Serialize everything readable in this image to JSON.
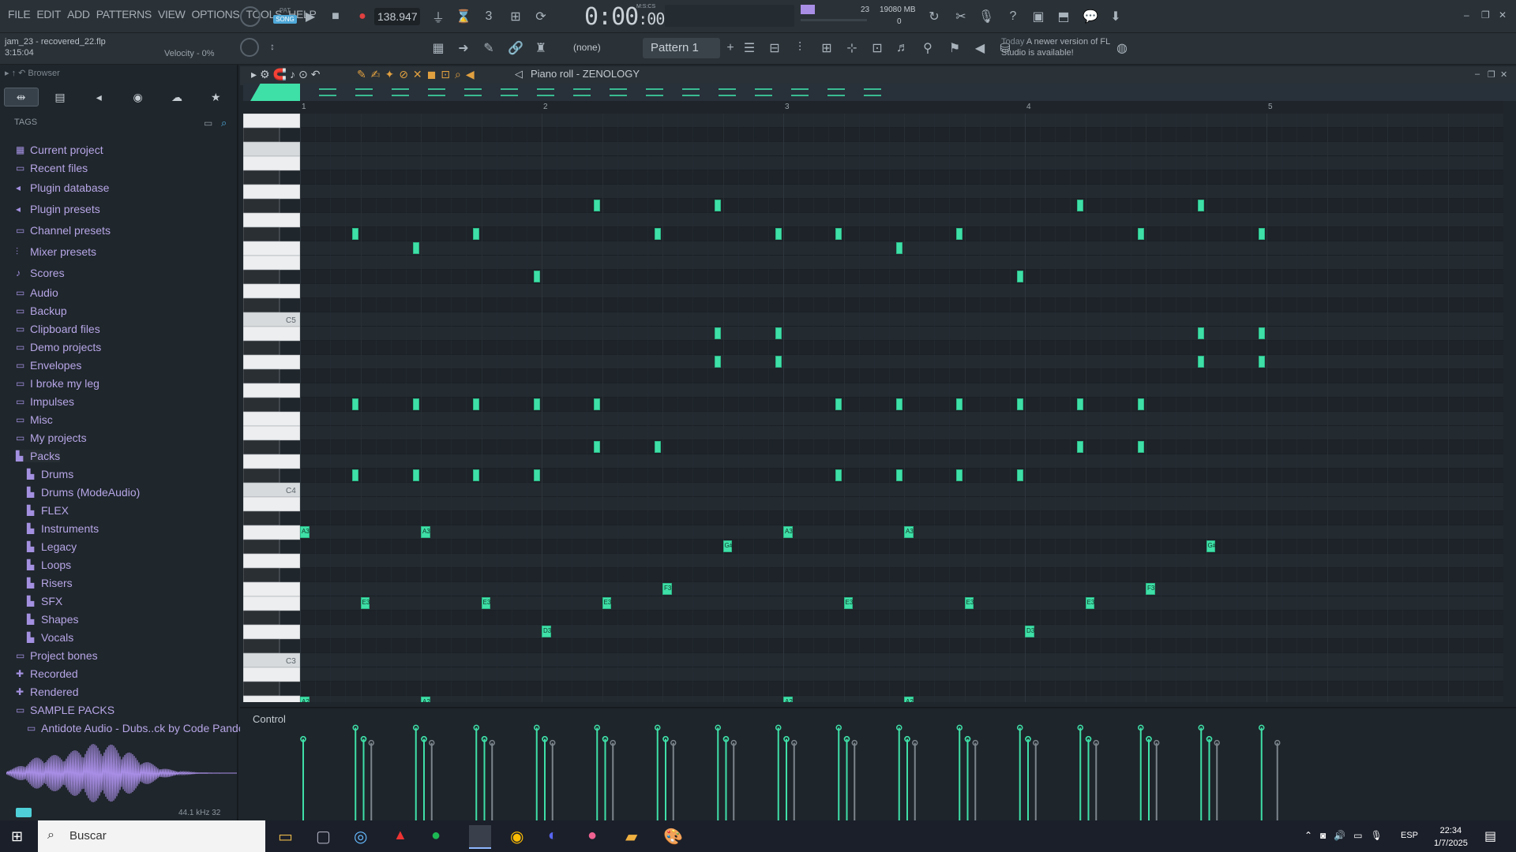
{
  "menu": [
    "FILE",
    "EDIT",
    "ADD",
    "PATTERNS",
    "VIEW",
    "OPTIONS",
    "TOOLS",
    "HELP"
  ],
  "transport": {
    "pat_label": "PAT",
    "song_label": "SONG",
    "bpm": "138.947",
    "time": "0:00",
    "time_sub": ":00",
    "time_unit": "M:S:CS"
  },
  "memory": {
    "cpu": "23",
    "mem": "19080 MB",
    "voices": "0"
  },
  "project": {
    "name": "jam_23 - recovered_22.flp",
    "time": "3:15:04",
    "velocity": "Velocity - 0%"
  },
  "pattern": {
    "name": "Pattern 1",
    "none": "(none)"
  },
  "news": {
    "today": "Today",
    "text": "A newer version of FL Studio is available!"
  },
  "browser": {
    "title": "Browser",
    "tags": "TAGS",
    "items": [
      {
        "label": "Current project",
        "icon": "project-icon"
      },
      {
        "label": "Recent files",
        "icon": "folder-icon"
      },
      {
        "label": "Plugin database",
        "icon": "plugin-icon"
      },
      {
        "label": "Plugin presets",
        "icon": "plugin-icon"
      },
      {
        "label": "Channel presets",
        "icon": "channel-icon"
      },
      {
        "label": "Mixer presets",
        "icon": "mixer-icon"
      },
      {
        "label": "Scores",
        "icon": "note-icon"
      },
      {
        "label": "Audio",
        "icon": "folder-icon"
      },
      {
        "label": "Backup",
        "icon": "folder-icon"
      },
      {
        "label": "Clipboard files",
        "icon": "folder-icon"
      },
      {
        "label": "Demo projects",
        "icon": "folder-icon"
      },
      {
        "label": "Envelopes",
        "icon": "folder-icon"
      },
      {
        "label": "I broke my leg",
        "icon": "folder-icon"
      },
      {
        "label": "Impulses",
        "icon": "folder-icon"
      },
      {
        "label": "Misc",
        "icon": "folder-icon"
      },
      {
        "label": "My projects",
        "icon": "folder-icon"
      },
      {
        "label": "Packs",
        "icon": "pack-icon"
      },
      {
        "label": "Drums",
        "icon": "pack-icon",
        "sub": true
      },
      {
        "label": "Drums (ModeAudio)",
        "icon": "pack-icon",
        "sub": true
      },
      {
        "label": "FLEX",
        "icon": "pack-icon",
        "sub": true
      },
      {
        "label": "Instruments",
        "icon": "pack-icon",
        "sub": true
      },
      {
        "label": "Legacy",
        "icon": "pack-icon",
        "sub": true
      },
      {
        "label": "Loops",
        "icon": "pack-icon",
        "sub": true
      },
      {
        "label": "Risers",
        "icon": "pack-icon",
        "sub": true
      },
      {
        "label": "SFX",
        "icon": "pack-icon",
        "sub": true
      },
      {
        "label": "Shapes",
        "icon": "pack-icon",
        "sub": true
      },
      {
        "label": "Vocals",
        "icon": "pack-icon",
        "sub": true
      },
      {
        "label": "Project bones",
        "icon": "folder-icon"
      },
      {
        "label": "Recorded",
        "icon": "plus-icon"
      },
      {
        "label": "Rendered",
        "icon": "plus-icon"
      },
      {
        "label": "SAMPLE PACKS",
        "icon": "folder-icon"
      },
      {
        "label": "Antidote Audio - Dubs..ck by Code Pandorum",
        "icon": "folder-icon",
        "sub": true
      }
    ],
    "samplerate": "44.1 kHz 32"
  },
  "pianoroll": {
    "title": "Piano roll - ZENOLOGY",
    "bars": [
      "1",
      "2",
      "3",
      "4",
      "5"
    ],
    "key_labels": [
      "C5",
      "C4",
      "C3"
    ],
    "control": "Control",
    "notes": [
      {
        "label": "A3",
        "bar": 0.0,
        "len": 0.13,
        "pitch": "A3"
      },
      {
        "label": "A3",
        "bar": 0.5,
        "len": 0.13,
        "pitch": "A3"
      },
      {
        "label": "A3",
        "bar": 2.0,
        "len": 0.13,
        "pitch": "A3"
      },
      {
        "label": "A3",
        "bar": 2.5,
        "len": 0.13,
        "pitch": "A3"
      },
      {
        "label": "G#3",
        "bar": 1.75,
        "len": 0.13,
        "pitch": "G#3"
      },
      {
        "label": "G#3",
        "bar": 3.75,
        "len": 0.13,
        "pitch": "G#3"
      },
      {
        "label": "F3",
        "bar": 1.5,
        "len": 0.13,
        "pitch": "F3"
      },
      {
        "label": "F3",
        "bar": 3.5,
        "len": 0.13,
        "pitch": "F3"
      },
      {
        "label": "E3",
        "bar": 0.25,
        "len": 0.13,
        "pitch": "E3"
      },
      {
        "label": "E3",
        "bar": 0.75,
        "len": 0.13,
        "pitch": "E3"
      },
      {
        "label": "E3",
        "bar": 1.25,
        "len": 0.13,
        "pitch": "E3"
      },
      {
        "label": "E3",
        "bar": 2.25,
        "len": 0.13,
        "pitch": "E3"
      },
      {
        "label": "E3",
        "bar": 2.75,
        "len": 0.13,
        "pitch": "E3"
      },
      {
        "label": "E3",
        "bar": 3.25,
        "len": 0.13,
        "pitch": "E3"
      },
      {
        "label": "D3",
        "bar": 1.0,
        "len": 0.13,
        "pitch": "D3"
      },
      {
        "label": "D3",
        "bar": 3.0,
        "len": 0.13,
        "pitch": "D3"
      },
      {
        "label": "A2",
        "bar": 0.0,
        "len": 0.13,
        "pitch": "A2"
      },
      {
        "label": "A2",
        "bar": 0.5,
        "len": 0.13,
        "pitch": "A2"
      },
      {
        "label": "A2",
        "bar": 2.0,
        "len": 0.13,
        "pitch": "A2"
      },
      {
        "label": "A2",
        "bar": 2.5,
        "len": 0.13,
        "pitch": "A2"
      },
      {
        "label": "G#2",
        "bar": 1.75,
        "len": 0.13,
        "pitch": "G#2"
      },
      {
        "label": "G#2",
        "bar": 3.75,
        "len": 0.13,
        "pitch": "G#2"
      },
      {
        "label": "F2",
        "bar": 1.5,
        "len": 0.13,
        "pitch": "F2"
      },
      {
        "label": "F2",
        "bar": 3.5,
        "len": 0.13,
        "pitch": "F2"
      },
      {
        "label": "E2",
        "bar": 0.25,
        "len": 0.13,
        "pitch": "E2"
      },
      {
        "label": "E2",
        "bar": 0.75,
        "len": 0.13,
        "pitch": "E2"
      },
      {
        "label": "E2",
        "bar": 1.25,
        "len": 0.13,
        "pitch": "E2"
      },
      {
        "label": "E2",
        "bar": 2.25,
        "len": 0.13,
        "pitch": "E2"
      },
      {
        "label": "E2",
        "bar": 2.75,
        "len": 0.13,
        "pitch": "E2"
      },
      {
        "label": "E2",
        "bar": 3.25,
        "len": 0.13,
        "pitch": "E2"
      },
      {
        "label": "D2",
        "bar": 1.0,
        "len": 0.13,
        "pitch": "D2"
      },
      {
        "label": "D2",
        "bar": 3.0,
        "len": 0.13,
        "pitch": "D2"
      }
    ],
    "chords": [
      {
        "bar": 0.125,
        "pitches": [
          "F#5",
          "F#4",
          "C#4"
        ]
      },
      {
        "bar": 0.375,
        "pitches": [
          "F5",
          "F#4",
          "C#4"
        ]
      },
      {
        "bar": 0.625,
        "pitches": [
          "F#5",
          "F#4",
          "C#4"
        ]
      },
      {
        "bar": 0.875,
        "pitches": [
          "D#5",
          "F#4",
          "C#4"
        ]
      },
      {
        "bar": 1.125,
        "pitches": [
          "G#5",
          "F#4",
          "D#4"
        ]
      },
      {
        "bar": 1.375,
        "pitches": [
          "F#5",
          "D#4"
        ]
      },
      {
        "bar": 1.625,
        "pitches": [
          "G#5",
          "B4",
          "A4"
        ]
      },
      {
        "bar": 1.875,
        "pitches": [
          "F#5",
          "B4",
          "A4"
        ]
      },
      {
        "bar": 2.125,
        "pitches": [
          "F#5",
          "F#4",
          "C#4"
        ]
      },
      {
        "bar": 2.375,
        "pitches": [
          "F5",
          "F#4",
          "C#4"
        ]
      },
      {
        "bar": 2.625,
        "pitches": [
          "F#5",
          "F#4",
          "C#4"
        ]
      },
      {
        "bar": 2.875,
        "pitches": [
          "D#5",
          "F#4",
          "C#4"
        ]
      },
      {
        "bar": 3.125,
        "pitches": [
          "G#5",
          "F#4",
          "D#4"
        ]
      },
      {
        "bar": 3.375,
        "pitches": [
          "F#5",
          "F#4",
          "D#4"
        ]
      },
      {
        "bar": 3.625,
        "pitches": [
          "G#5",
          "B4",
          "A4"
        ]
      },
      {
        "bar": 3.875,
        "pitches": [
          "F#5",
          "B4",
          "A4"
        ]
      }
    ]
  },
  "taskbar": {
    "search": "Buscar",
    "lang": "ESP",
    "time": "22:34",
    "date": "1/7/2025"
  },
  "colors": {
    "note": "#3fe0a8",
    "folder": "#b7a6e6",
    "accent": "#9a7fe0"
  }
}
